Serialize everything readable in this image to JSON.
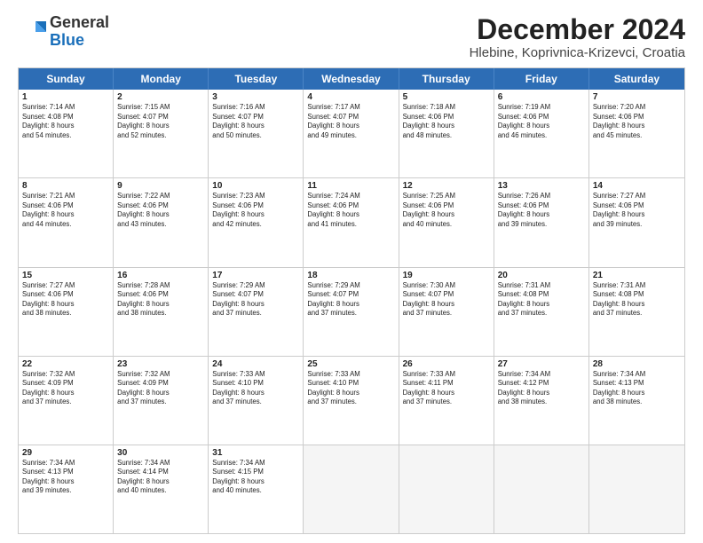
{
  "header": {
    "logo_general": "General",
    "logo_blue": "Blue",
    "month_title": "December 2024",
    "location": "Hlebine, Koprivnica-Krizevci, Croatia"
  },
  "days_of_week": [
    "Sunday",
    "Monday",
    "Tuesday",
    "Wednesday",
    "Thursday",
    "Friday",
    "Saturday"
  ],
  "weeks": [
    [
      {
        "day": "1",
        "lines": [
          "Sunrise: 7:14 AM",
          "Sunset: 4:08 PM",
          "Daylight: 8 hours",
          "and 54 minutes."
        ]
      },
      {
        "day": "2",
        "lines": [
          "Sunrise: 7:15 AM",
          "Sunset: 4:07 PM",
          "Daylight: 8 hours",
          "and 52 minutes."
        ]
      },
      {
        "day": "3",
        "lines": [
          "Sunrise: 7:16 AM",
          "Sunset: 4:07 PM",
          "Daylight: 8 hours",
          "and 50 minutes."
        ]
      },
      {
        "day": "4",
        "lines": [
          "Sunrise: 7:17 AM",
          "Sunset: 4:07 PM",
          "Daylight: 8 hours",
          "and 49 minutes."
        ]
      },
      {
        "day": "5",
        "lines": [
          "Sunrise: 7:18 AM",
          "Sunset: 4:06 PM",
          "Daylight: 8 hours",
          "and 48 minutes."
        ]
      },
      {
        "day": "6",
        "lines": [
          "Sunrise: 7:19 AM",
          "Sunset: 4:06 PM",
          "Daylight: 8 hours",
          "and 46 minutes."
        ]
      },
      {
        "day": "7",
        "lines": [
          "Sunrise: 7:20 AM",
          "Sunset: 4:06 PM",
          "Daylight: 8 hours",
          "and 45 minutes."
        ]
      }
    ],
    [
      {
        "day": "8",
        "lines": [
          "Sunrise: 7:21 AM",
          "Sunset: 4:06 PM",
          "Daylight: 8 hours",
          "and 44 minutes."
        ]
      },
      {
        "day": "9",
        "lines": [
          "Sunrise: 7:22 AM",
          "Sunset: 4:06 PM",
          "Daylight: 8 hours",
          "and 43 minutes."
        ]
      },
      {
        "day": "10",
        "lines": [
          "Sunrise: 7:23 AM",
          "Sunset: 4:06 PM",
          "Daylight: 8 hours",
          "and 42 minutes."
        ]
      },
      {
        "day": "11",
        "lines": [
          "Sunrise: 7:24 AM",
          "Sunset: 4:06 PM",
          "Daylight: 8 hours",
          "and 41 minutes."
        ]
      },
      {
        "day": "12",
        "lines": [
          "Sunrise: 7:25 AM",
          "Sunset: 4:06 PM",
          "Daylight: 8 hours",
          "and 40 minutes."
        ]
      },
      {
        "day": "13",
        "lines": [
          "Sunrise: 7:26 AM",
          "Sunset: 4:06 PM",
          "Daylight: 8 hours",
          "and 39 minutes."
        ]
      },
      {
        "day": "14",
        "lines": [
          "Sunrise: 7:27 AM",
          "Sunset: 4:06 PM",
          "Daylight: 8 hours",
          "and 39 minutes."
        ]
      }
    ],
    [
      {
        "day": "15",
        "lines": [
          "Sunrise: 7:27 AM",
          "Sunset: 4:06 PM",
          "Daylight: 8 hours",
          "and 38 minutes."
        ]
      },
      {
        "day": "16",
        "lines": [
          "Sunrise: 7:28 AM",
          "Sunset: 4:06 PM",
          "Daylight: 8 hours",
          "and 38 minutes."
        ]
      },
      {
        "day": "17",
        "lines": [
          "Sunrise: 7:29 AM",
          "Sunset: 4:07 PM",
          "Daylight: 8 hours",
          "and 37 minutes."
        ]
      },
      {
        "day": "18",
        "lines": [
          "Sunrise: 7:29 AM",
          "Sunset: 4:07 PM",
          "Daylight: 8 hours",
          "and 37 minutes."
        ]
      },
      {
        "day": "19",
        "lines": [
          "Sunrise: 7:30 AM",
          "Sunset: 4:07 PM",
          "Daylight: 8 hours",
          "and 37 minutes."
        ]
      },
      {
        "day": "20",
        "lines": [
          "Sunrise: 7:31 AM",
          "Sunset: 4:08 PM",
          "Daylight: 8 hours",
          "and 37 minutes."
        ]
      },
      {
        "day": "21",
        "lines": [
          "Sunrise: 7:31 AM",
          "Sunset: 4:08 PM",
          "Daylight: 8 hours",
          "and 37 minutes."
        ]
      }
    ],
    [
      {
        "day": "22",
        "lines": [
          "Sunrise: 7:32 AM",
          "Sunset: 4:09 PM",
          "Daylight: 8 hours",
          "and 37 minutes."
        ]
      },
      {
        "day": "23",
        "lines": [
          "Sunrise: 7:32 AM",
          "Sunset: 4:09 PM",
          "Daylight: 8 hours",
          "and 37 minutes."
        ]
      },
      {
        "day": "24",
        "lines": [
          "Sunrise: 7:33 AM",
          "Sunset: 4:10 PM",
          "Daylight: 8 hours",
          "and 37 minutes."
        ]
      },
      {
        "day": "25",
        "lines": [
          "Sunrise: 7:33 AM",
          "Sunset: 4:10 PM",
          "Daylight: 8 hours",
          "and 37 minutes."
        ]
      },
      {
        "day": "26",
        "lines": [
          "Sunrise: 7:33 AM",
          "Sunset: 4:11 PM",
          "Daylight: 8 hours",
          "and 37 minutes."
        ]
      },
      {
        "day": "27",
        "lines": [
          "Sunrise: 7:34 AM",
          "Sunset: 4:12 PM",
          "Daylight: 8 hours",
          "and 38 minutes."
        ]
      },
      {
        "day": "28",
        "lines": [
          "Sunrise: 7:34 AM",
          "Sunset: 4:13 PM",
          "Daylight: 8 hours",
          "and 38 minutes."
        ]
      }
    ],
    [
      {
        "day": "29",
        "lines": [
          "Sunrise: 7:34 AM",
          "Sunset: 4:13 PM",
          "Daylight: 8 hours",
          "and 39 minutes."
        ]
      },
      {
        "day": "30",
        "lines": [
          "Sunrise: 7:34 AM",
          "Sunset: 4:14 PM",
          "Daylight: 8 hours",
          "and 40 minutes."
        ]
      },
      {
        "day": "31",
        "lines": [
          "Sunrise: 7:34 AM",
          "Sunset: 4:15 PM",
          "Daylight: 8 hours",
          "and 40 minutes."
        ]
      },
      null,
      null,
      null,
      null
    ]
  ]
}
